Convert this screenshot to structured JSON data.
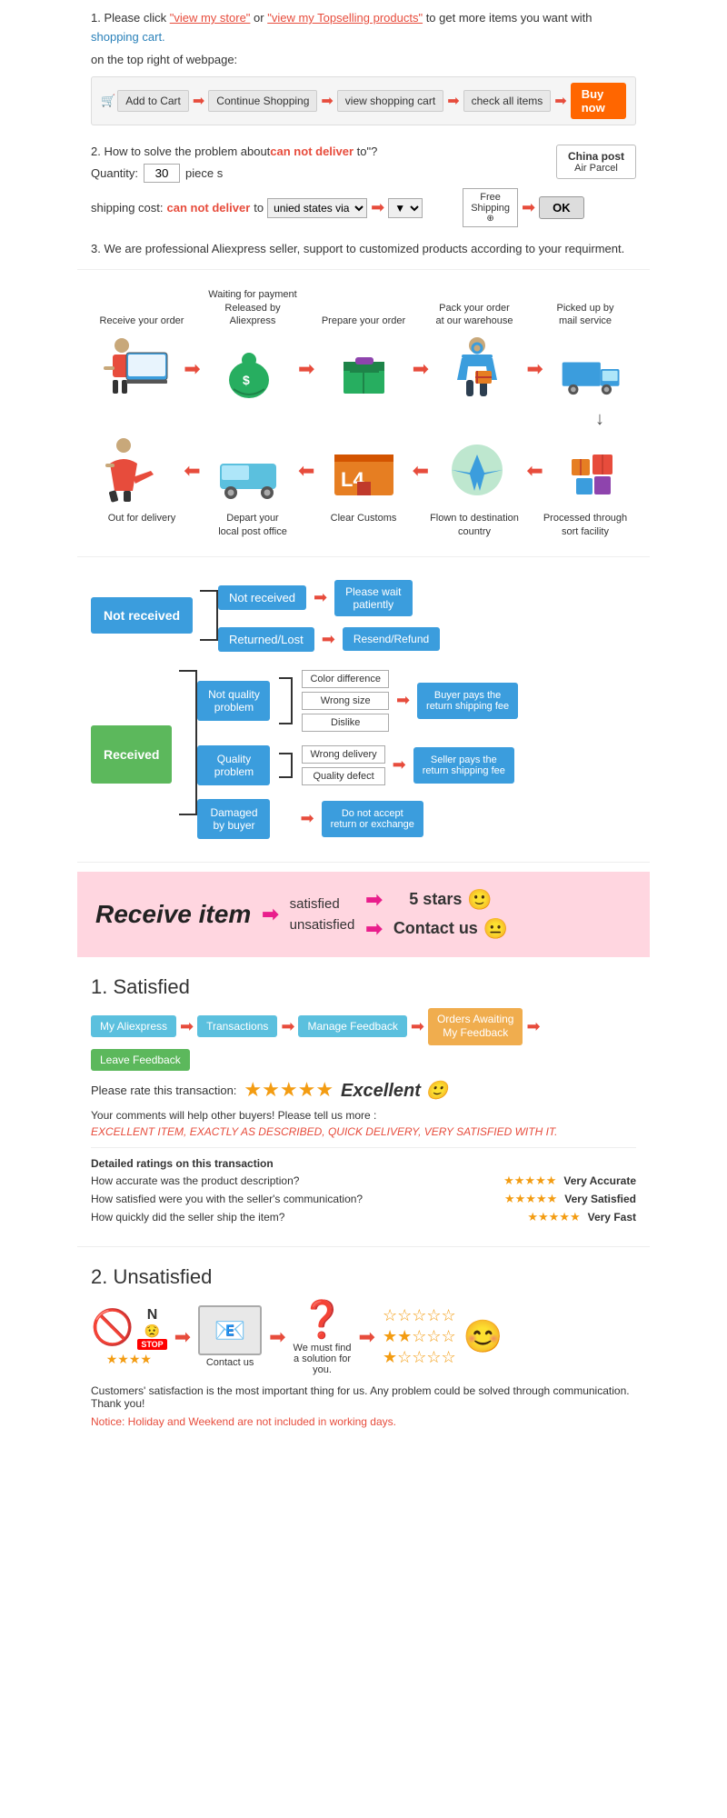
{
  "step1": {
    "number": "1.",
    "text_before": "Please click ",
    "link1": "\"view my store\"",
    "text_mid": "or ",
    "link2": "\"view my Topselling products\"",
    "text_after": " to get more items you want with",
    "shopping_cart": "shopping cart.",
    "subtitle": "on the top right of webpage:",
    "cart_flow": {
      "add_to_cart": "Add to Cart",
      "continue": "Continue Shopping",
      "view_cart": "view shopping cart",
      "check_all": "check all items",
      "buy_now": "Buy now"
    }
  },
  "step2": {
    "number": "2.",
    "text": "How to solve the problem about",
    "can_not": "can not deliver",
    "text_after": " to\"?",
    "china_post": {
      "title": "China post",
      "sub": "Air Parcel"
    },
    "quantity_label": "Quantity:",
    "quantity_value": "30",
    "piece_label": "piece s",
    "shipping_label": "shipping cost:",
    "can_not_deliver": "can not deliver",
    "to_label": " to ",
    "via_label": "unied states via",
    "free_shipping": "Free\nShipping",
    "ok": "OK"
  },
  "step3": {
    "number": "3.",
    "text": "We are professional Aliexpress seller, support to customized products according to your requirment."
  },
  "process_flow": {
    "top_labels": [
      "Receive your order",
      "Waiting for payment\nReleased by Aliexpress",
      "Prepare your order",
      "Pack your order\nat our warehouse",
      "Picked up by\nmail service"
    ],
    "icons": [
      "🧑‍💻",
      "💰",
      "📦",
      "👷",
      "🚛"
    ],
    "bottom_labels": [
      "Out for delivery",
      "Depart your\nlocal post office",
      "Clear Customs",
      "Flown to destination\ncountry",
      "Processed through\nsort facility"
    ],
    "bottom_icons": [
      "🏃",
      "🚐",
      "🏢",
      "✈️",
      "📬"
    ]
  },
  "flow_chart": {
    "not_received_label": "Not received",
    "not_received_box1": "Not received",
    "not_received_box2": "Returned/Lost",
    "not_received_result1": "Please wait\npatiently",
    "not_received_result2": "Resend/Refund",
    "received_label": "Received",
    "not_quality_label": "Not quality\nproblem",
    "quality_label": "Quality\nproblem",
    "damaged_label": "Damaged\nby buyer",
    "sub_boxes_not_quality": [
      "Color difference",
      "Wrong size",
      "Dislike"
    ],
    "sub_boxes_quality": [
      "Wrong delivery",
      "Quality defect"
    ],
    "not_quality_result": "Buyer pays the\nreturn shipping fee",
    "quality_result": "Seller pays the\nreturn shipping fee",
    "damaged_result": "Do not accept\nreturn or exchange"
  },
  "satisfaction_banner": {
    "receive_item": "Receive item",
    "satisfied": "satisfied",
    "unsatisfied": "unsatisfied",
    "five_stars": "5 stars",
    "contact_us": "Contact us",
    "smiley_happy": "🙂",
    "smiley_neutral": "😐"
  },
  "satisfied_section": {
    "number": "1.",
    "title": "Satisfied",
    "nav": {
      "my_aliexpress": "My Aliexpress",
      "transactions": "Transactions",
      "manage_feedback": "Manage Feedback",
      "orders_awaiting": "Orders Awaiting\nMy Feedback",
      "leave_feedback": "Leave Feedback"
    },
    "rate_text": "Please rate this transaction:",
    "stars": "★★★★★",
    "excellent": "Excellent 🙂",
    "comments_text": "Your comments will help other buyers! Please tell us more :",
    "red_comment": "EXCELLENT ITEM, EXACTLY AS DESCRIBED, QUICK DELIVERY, VERY SATISFIED WITH IT.",
    "detailed_label": "Detailed ratings on this transaction",
    "ratings": [
      {
        "question": "How accurate was the product description?",
        "stars": "★★★★★",
        "result": "Very Accurate"
      },
      {
        "question": "How satisfied were you with the seller's communication?",
        "stars": "★★★★★",
        "result": "Very Satisfied"
      },
      {
        "question": "How quickly did the seller ship the item?",
        "stars": "★★★★★",
        "result": "Very Fast"
      }
    ]
  },
  "unsatisfied_section": {
    "number": "2.",
    "title": "Unsatisfied",
    "flow": [
      {
        "icon": "🚫",
        "label": ""
      },
      {
        "icon": "📧",
        "label": "Contact us"
      },
      {
        "icon": "❓",
        "label": "We must find\na solution for\nyou."
      }
    ],
    "stars_rows": [
      "☆☆☆☆☆",
      "★★☆☆☆",
      "★☆☆☆☆"
    ],
    "smiley": "😊",
    "notice1": "Customers' satisfaction is the most important thing for us. Any problem could be solved through communication. Thank you!",
    "notice2": "Notice: Holiday and Weekend are not included in working days."
  }
}
